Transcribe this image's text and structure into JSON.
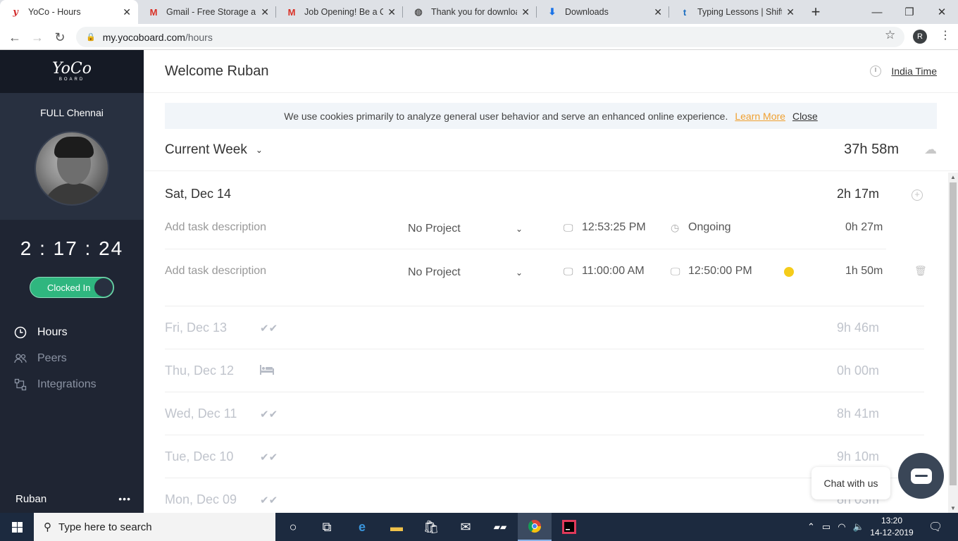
{
  "browser": {
    "tabs": [
      {
        "title": "YoCo - Hours",
        "favicon": "yoco-icon",
        "active": true
      },
      {
        "title": "Gmail - Free Storage and",
        "favicon": "gmail-icon",
        "active": false
      },
      {
        "title": "Job Opening! Be a Client",
        "favicon": "gmail-icon",
        "active": false
      },
      {
        "title": "Thank you for downloading",
        "favicon": "globe-icon",
        "active": false
      },
      {
        "title": "Downloads",
        "favicon": "download-icon",
        "active": false
      },
      {
        "title": "Typing Lessons | Shift Key",
        "favicon": "typing-icon",
        "active": false
      }
    ],
    "new_tab": "+",
    "url_domain": "my.yocoboard.com",
    "url_path": "/hours",
    "profile_initial": "R"
  },
  "sidebar": {
    "logo_main": "YoCo",
    "logo_sub": "BOARD",
    "team": "FULL Chennai",
    "timer": "2 : 17 : 24",
    "clock_status": "Clocked In",
    "nav": [
      {
        "label": "Hours",
        "icon": "clock-icon",
        "active": true
      },
      {
        "label": "Peers",
        "icon": "peers-icon",
        "active": false
      },
      {
        "label": "Integrations",
        "icon": "integrations-icon",
        "active": false
      }
    ],
    "user_name": "Ruban",
    "more": "•••"
  },
  "header": {
    "welcome": "Welcome Ruban",
    "timezone": "India Time"
  },
  "cookie": {
    "text": "We use cookies primarily to analyze general user behavior and serve an enhanced online experience.",
    "learn_more": "Learn More",
    "close": "Close"
  },
  "week": {
    "label": "Current Week",
    "total": "37h 58m"
  },
  "today": {
    "label": "Sat, Dec 14",
    "total": "2h 17m",
    "entries": [
      {
        "description_placeholder": "Add task description",
        "project": "No Project",
        "start": "12:53:25 PM",
        "end": "Ongoing",
        "duration": "0h 27m"
      },
      {
        "description_placeholder": "Add task description",
        "project": "No Project",
        "start": "11:00:00 AM",
        "end": "12:50:00 PM",
        "duration": "1h 50m"
      }
    ]
  },
  "past_days": [
    {
      "label": "Fri, Dec 13",
      "icon": "double-check-icon",
      "total": "9h 46m"
    },
    {
      "label": "Thu, Dec 12",
      "icon": "bed-icon",
      "total": "0h 00m"
    },
    {
      "label": "Wed, Dec 11",
      "icon": "double-check-icon",
      "total": "8h 41m"
    },
    {
      "label": "Tue, Dec 10",
      "icon": "double-check-icon",
      "total": "9h 10m"
    },
    {
      "label": "Mon, Dec 09",
      "icon": "double-check-icon",
      "total": "8h 03m"
    }
  ],
  "chat": {
    "label": "Chat with us"
  },
  "taskbar": {
    "search_placeholder": "Type here to search",
    "time": "13:20",
    "date": "14-12-2019"
  },
  "colors": {
    "sidebar_bg": "#1f2533",
    "clocked_in_green": "#2fb67f",
    "learn_more_orange": "#f0a030",
    "ongoing_yellow": "#f5cc1a"
  }
}
